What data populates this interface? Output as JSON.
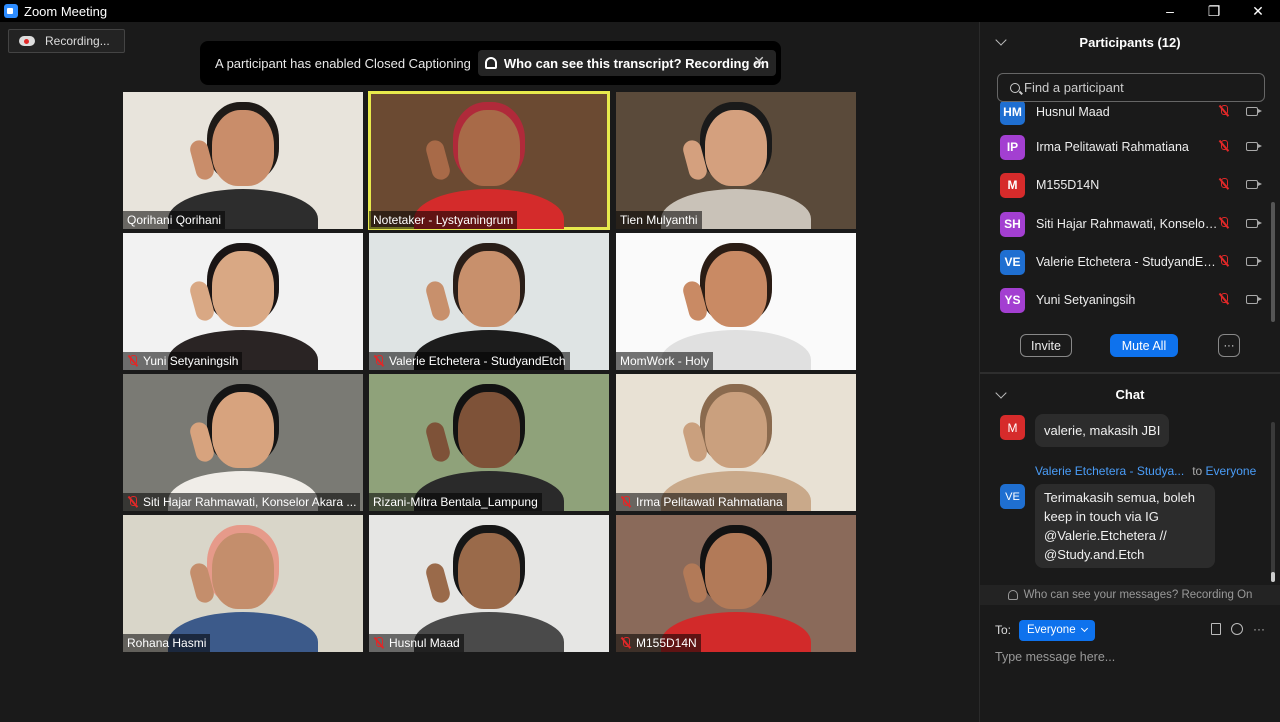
{
  "window": {
    "title": "Zoom Meeting",
    "minimize": "–",
    "restore": "❐",
    "close": "✕"
  },
  "recording": {
    "label": "Recording..."
  },
  "banner": {
    "message": "A participant has enabled Closed Captioning",
    "pill": "Who can see this transcript? Recording on",
    "close": "✕"
  },
  "tiles": [
    {
      "name": "Qorihani Qorihani",
      "muted": false,
      "active": false,
      "bg": "#e8e4dc",
      "skin": "#c98d6a",
      "shirt": "#2d2d2d",
      "hair": "#1e1a17"
    },
    {
      "name": "Notetaker - Lystyaningrum",
      "muted": false,
      "active": true,
      "bg": "#6b4a32",
      "skin": "#a86a48",
      "shirt": "#d42b2b",
      "hair": "#b02a3a"
    },
    {
      "name": "Tien Mulyanthi",
      "muted": false,
      "active": false,
      "bg": "#5a4a3a",
      "skin": "#d4a07e",
      "shirt": "#c9c2b8",
      "hair": "#1a1a1a"
    },
    {
      "name": "Yuni Setyaningsih",
      "muted": true,
      "active": false,
      "bg": "#f2f2f2",
      "skin": "#d9a884",
      "shirt": "#2a2424",
      "hair": "#1a1515"
    },
    {
      "name": "Valerie Etchetera - StudyandEtch",
      "muted": true,
      "active": false,
      "bg": "#dfe4e4",
      "skin": "#c8906c",
      "shirt": "#1c1c1c",
      "hair": "#2a1e18"
    },
    {
      "name": "MomWork - Holy",
      "muted": false,
      "active": false,
      "bg": "#fafafa",
      "skin": "#c98a64",
      "shirt": "#e0e0e0",
      "hair": "#2a1c14"
    },
    {
      "name": "Siti Hajar Rahmawati, Konselor Akara ...",
      "muted": true,
      "active": false,
      "bg": "#7a7a74",
      "skin": "#d7a37e",
      "shirt": "#f0ede8",
      "hair": "#151515"
    },
    {
      "name": "Rizani-Mitra Bentala_Lampung",
      "muted": false,
      "active": false,
      "bg": "#8fa27a",
      "skin": "#7e5238",
      "shirt": "#2a2a2a",
      "hair": "#121212"
    },
    {
      "name": "Irma Pelitawati Rahmatiana",
      "muted": true,
      "active": false,
      "bg": "#e8e1d4",
      "skin": "#caa07e",
      "shirt": "#c9a98a",
      "hair": "#8a6a4e"
    },
    {
      "name": "Rohana Hasmi",
      "muted": false,
      "active": false,
      "bg": "#d9d6c9",
      "skin": "#c48e6c",
      "shirt": "#3c5a8a",
      "hair": "#e69a8a"
    },
    {
      "name": "Husnul Maad",
      "muted": true,
      "active": false,
      "bg": "#e6e6e4",
      "skin": "#9a6a4a",
      "shirt": "#4a4a4a",
      "hair": "#161616"
    },
    {
      "name": "M155D14N",
      "muted": true,
      "active": false,
      "bg": "#8a6a5a",
      "skin": "#b27a58",
      "shirt": "#d22a2a",
      "hair": "#121212"
    }
  ],
  "participants": {
    "title": "Participants (12)",
    "search_placeholder": "Find a participant",
    "items": [
      {
        "initials": "HM",
        "name": "Husnul Maad",
        "color": "#1f6fd1"
      },
      {
        "initials": "IP",
        "name": "Irma Pelitawati Rahmatiana",
        "color": "#a33fd1"
      },
      {
        "initials": "M",
        "name": "M155D14N",
        "color": "#d62b2b"
      },
      {
        "initials": "SH",
        "name": "Siti Hajar Rahmawati, Konselor ...",
        "color": "#a33fd1"
      },
      {
        "initials": "VE",
        "name": "Valerie Etchetera - StudyandEtch",
        "color": "#1f6fd1"
      },
      {
        "initials": "YS",
        "name": "Yuni Setyaningsih",
        "color": "#a33fd1"
      }
    ],
    "invite_label": "Invite",
    "mute_all_label": "Mute All",
    "more_label": "···"
  },
  "chat": {
    "title": "Chat",
    "messages": [
      {
        "initials": "M",
        "color": "#d62b2b",
        "text": "valerie, makasih JBI"
      },
      {
        "initials": "VE",
        "color": "#1f6fd1",
        "from": "Valerie Etchetera - Studya...",
        "to_label": "to",
        "to": "Everyone",
        "lines": [
          "Terimakasih semua, boleh",
          "keep in touch via IG",
          "@Valerie.Etchetera //",
          "@Study.and.Etch"
        ]
      }
    ],
    "notice": "Who can see your messages? Recording On",
    "to_prefix": "To:",
    "to_value": "Everyone",
    "more": "···",
    "input_placeholder": "Type message here..."
  }
}
